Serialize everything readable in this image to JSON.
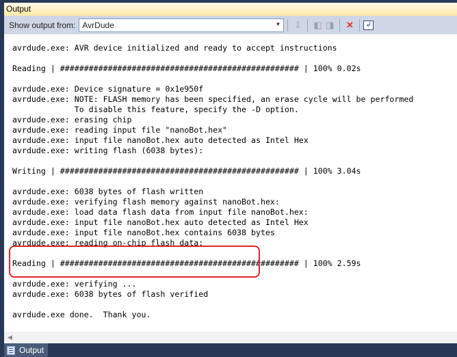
{
  "window": {
    "title": "Output"
  },
  "toolbar": {
    "show_output_label": "Show output from:",
    "source": "AvrDude",
    "icons": [
      "go-to-line-icon",
      "previous-message-icon",
      "next-message-icon",
      "clear-all-icon",
      "word-wrap-icon"
    ]
  },
  "output_lines": [
    "avrdude.exe: AVR device initialized and ready to accept instructions",
    "",
    "Reading | ################################################## | 100% 0.02s",
    "",
    "avrdude.exe: Device signature = 0x1e950f",
    "avrdude.exe: NOTE: FLASH memory has been specified, an erase cycle will be performed",
    "             To disable this feature, specify the -D option.",
    "avrdude.exe: erasing chip",
    "avrdude.exe: reading input file \"nanoBot.hex\"",
    "avrdude.exe: input file nanoBot.hex auto detected as Intel Hex",
    "avrdude.exe: writing flash (6038 bytes):",
    "",
    "Writing | ################################################## | 100% 3.04s",
    "",
    "avrdude.exe: 6038 bytes of flash written",
    "avrdude.exe: verifying flash memory against nanoBot.hex:",
    "avrdude.exe: load data flash data from input file nanoBot.hex:",
    "avrdude.exe: input file nanoBot.hex auto detected as Intel Hex",
    "avrdude.exe: input file nanoBot.hex contains 6038 bytes",
    "avrdude.exe: reading on-chip flash data:",
    "",
    "Reading | ################################################## | 100% 2.59s",
    "",
    "avrdude.exe: verifying ...",
    "avrdude.exe: 6038 bytes of flash verified",
    "",
    "avrdude.exe done.  Thank you."
  ],
  "highlight_color": "#e0242a",
  "bottom_tab": {
    "label": "Output"
  }
}
